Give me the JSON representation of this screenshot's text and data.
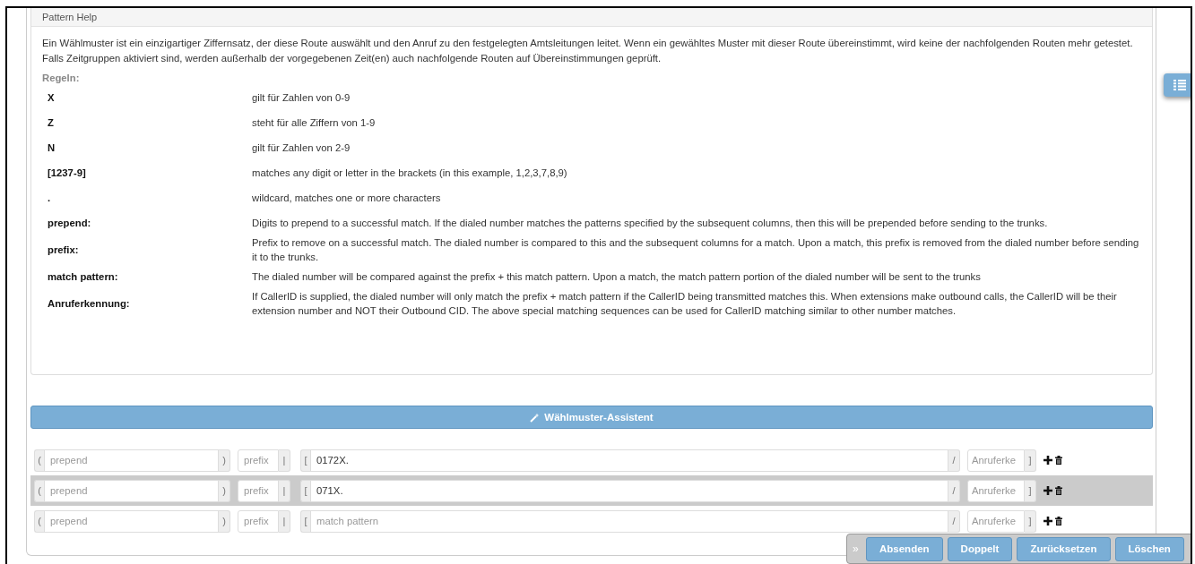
{
  "help": {
    "title": "Pattern Help",
    "intro": "Ein Wählmuster ist ein einzigartiger Ziffernsatz, der diese Route auswählt und den Anruf zu den festgelegten Amtsleitungen leitet. Wenn ein gewähltes Muster mit dieser Route übereinstimmt, wird keine der nachfolgenden Routen mehr getestet. Falls Zeitgruppen aktiviert sind, werden außerhalb der vorgegebenen Zeit(en) auch nachfolgende Routen auf Übereinstimmungen geprüft.",
    "rules_heading": "Regeln:",
    "rules": [
      {
        "term": "X",
        "description": "gilt für Zahlen von 0-9"
      },
      {
        "term": "Z",
        "description": "steht für alle Ziffern von 1-9"
      },
      {
        "term": "N",
        "description": "gilt für Zahlen von 2-9"
      },
      {
        "term": "[1237-9]",
        "description": "matches any digit or letter in the brackets (in this example, 1,2,3,7,8,9)"
      },
      {
        "term": ".",
        "description": "wildcard, matches one or more characters"
      },
      {
        "term": "prepend:",
        "description": "Digits to prepend to a successful match. If the dialed number matches the patterns specified by the subsequent columns, then this will be prepended before sending to the trunks."
      },
      {
        "term": "prefix:",
        "description": "Prefix to remove on a successful match. The dialed number is compared to this and the subsequent columns for a match. Upon a match, this prefix is removed from the dialed number before sending it to the trunks."
      },
      {
        "term": "match pattern:",
        "description": "The dialed number will be compared against the prefix + this match pattern. Upon a match, the match pattern portion of the dialed number will be sent to the trunks"
      },
      {
        "term": "Anruferkennung:",
        "description": "If CallerID is supplied, the dialed number will only match the prefix + match pattern if the CallerID being transmitted matches this. When extensions make outbound calls, the CallerID will be their extension number and NOT their Outbound CID. The above special matching sequences can be used for CallerID matching similar to other number matches."
      }
    ]
  },
  "wizard_button": "Wählmuster-Assistent",
  "patterns": [
    {
      "highlighted": false,
      "prepend": {
        "before": "(",
        "placeholder": "prepend",
        "after": ")"
      },
      "prefix": {
        "placeholder": "prefix",
        "after": "|"
      },
      "match": {
        "before": "[",
        "value": "0172X.",
        "after": "/"
      },
      "callerid": {
        "placeholder": "Anruferke",
        "after": "]"
      }
    },
    {
      "highlighted": true,
      "prepend": {
        "before": "(",
        "placeholder": "prepend",
        "after": ")"
      },
      "prefix": {
        "placeholder": "prefix",
        "after": "|"
      },
      "match": {
        "before": "[",
        "value": "071X.",
        "after": "/"
      },
      "callerid": {
        "placeholder": "Anruferke",
        "after": "]"
      }
    },
    {
      "highlighted": false,
      "prepend": {
        "before": "(",
        "placeholder": "prepend",
        "after": ")"
      },
      "prefix": {
        "placeholder": "prefix",
        "after": "|"
      },
      "match": {
        "before": "[",
        "placeholder": "match pattern",
        "after": "/"
      },
      "callerid": {
        "placeholder": "Anruferke",
        "after": "]"
      }
    }
  ],
  "action_bar": {
    "toggle": "»",
    "buttons": [
      "Absenden",
      "Doppelt",
      "Zurücksetzen",
      "Löschen"
    ]
  }
}
